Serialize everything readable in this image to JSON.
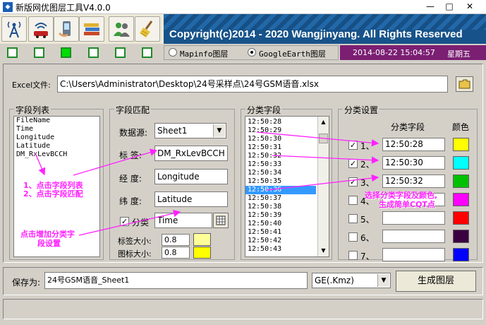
{
  "window": {
    "title": "新版网优图层工具V4.0.0",
    "min": "—",
    "max": "□",
    "close": "✕"
  },
  "toolbar": {
    "buttons": [
      "antenna-icon",
      "wifi-car-icon",
      "handset-icon",
      "books-icon",
      "users-icon",
      "broom-icon"
    ],
    "banner_text": "Copyright(c)2014 - 2020 Wangjinyang. All Rights Reserved"
  },
  "indicators": {
    "count": 6,
    "active_index": 2
  },
  "mode": {
    "options": [
      "Mapinfo图层",
      "GoogleEarth图层"
    ],
    "selected": "GoogleEarth图层"
  },
  "datetime": {
    "date_time": "2014-08-22 15:04:57",
    "weekday": "星期五"
  },
  "excel": {
    "label": "Excel文件:",
    "path": "C:\\Users\\Administrator\\Desktop\\24号采样点\\24号GSM语音.xlsx"
  },
  "field_list": {
    "title": "字段列表",
    "items": [
      "FileName",
      "Time",
      "Longitude",
      "Latitude",
      "DM_RxLevBCCH"
    ]
  },
  "field_match": {
    "title": "字段匹配",
    "source_label": "数据源:",
    "source_value": "Sheet1",
    "label_label": "标  签:",
    "label_value": "DM_RxLevBCCH",
    "lon_label": "经  度:",
    "lon_value": "Longitude",
    "lat_label": "纬  度:",
    "lat_value": "Latitude",
    "class_label": "分类",
    "class_check": "✓",
    "class_value": "Time",
    "label_size_label": "标签大小:",
    "label_size": "0.8",
    "icon_size_label": "图标大小:",
    "icon_size": "0.8"
  },
  "class_field": {
    "title": "分类字段",
    "items": [
      "12:50:28",
      "12:50:29",
      "12:50:30",
      "12:50:31",
      "12:50:32",
      "12:50:33",
      "12:50:34",
      "12:50:35",
      "12:50:36",
      "12:50:37",
      "12:50:38",
      "12:50:39",
      "12:50:40",
      "12:50:41",
      "12:50:42",
      "12:50:43"
    ],
    "selected": "12:50:36"
  },
  "class_settings": {
    "title": "分类设置",
    "col_field": "分类字段",
    "col_color": "颜色",
    "rows": [
      {
        "label": "1、",
        "checked": "✓",
        "value": "12:50:28",
        "color": "#ffff00"
      },
      {
        "label": "2、",
        "checked": "✓",
        "value": "12:50:30",
        "color": "#00ffff"
      },
      {
        "label": "3、",
        "checked": "✓",
        "value": "12:50:32",
        "color": "#00c000"
      },
      {
        "label": "4、",
        "checked": "",
        "value": "",
        "color": "#ff00ff"
      },
      {
        "label": "5、",
        "checked": "",
        "value": "",
        "color": "#ff0000"
      },
      {
        "label": "6、",
        "checked": "",
        "value": "",
        "color": "#3a0040"
      },
      {
        "label": "7、",
        "checked": "",
        "value": "",
        "color": "#0000ff"
      }
    ]
  },
  "annotations": {
    "a1": "1、点击字段列表",
    "a2": "2、点击字段匹配",
    "a3": "点击增加分类字",
    "a4": "段设置",
    "a5": "选择分类字段及颜色,",
    "a6": "生成简单CQT点"
  },
  "save": {
    "label": "保存为:",
    "value": "24号GSM语音_Sheet1",
    "format": "GE(.Kmz)",
    "generate": "生成图层"
  },
  "colors": {
    "banner": "#17538a",
    "datetime_bg": "#7b1f73",
    "annotation": "#ff22ff",
    "indicator": "#00dd00"
  }
}
